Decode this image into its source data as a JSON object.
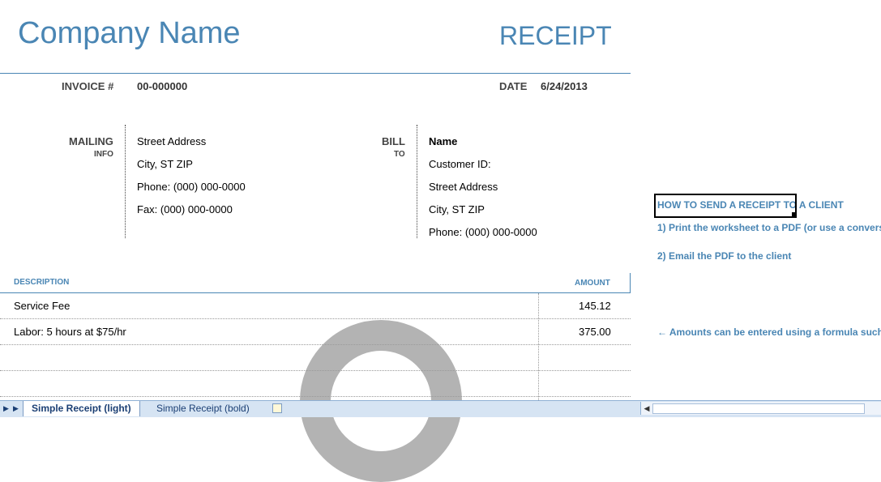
{
  "header": {
    "company_name": "Company Name",
    "doc_title": "RECEIPT"
  },
  "meta": {
    "invoice_label": "INVOICE #",
    "invoice_value": "00-000000",
    "date_label": "DATE",
    "date_value": "6/24/2013"
  },
  "mailing": {
    "label": "MAILING",
    "sublabel": "INFO",
    "lines": [
      "Street Address",
      "City, ST  ZIP",
      "Phone: (000) 000-0000",
      "Fax: (000) 000-0000"
    ]
  },
  "bill": {
    "label": "BILL",
    "sublabel": "TO",
    "name": "Name",
    "lines": [
      "Customer ID:",
      "Street Address",
      "City, ST  ZIP",
      "Phone: (000) 000-0000"
    ]
  },
  "table": {
    "col_description": "DESCRIPTION",
    "col_amount": "AMOUNT",
    "rows": [
      {
        "description": "Service Fee",
        "amount": "145.12"
      },
      {
        "description": "Labor: 5 hours at $75/hr",
        "amount": "375.00"
      }
    ]
  },
  "side_notes": {
    "selected_cell": "HOW TO SEND A RECEIPT TO A CLIENT",
    "step1": "1) Print the worksheet to a PDF (or use a convers",
    "step2": "2) Email the PDF to the client",
    "formula_note": "← Amounts can be entered using a formula such"
  },
  "sheet_tabs": {
    "active": "Simple Receipt (light)",
    "inactive": "Simple Receipt (bold)"
  },
  "colors": {
    "accent": "#4a86b4",
    "watermark": "#b3b3b3"
  }
}
